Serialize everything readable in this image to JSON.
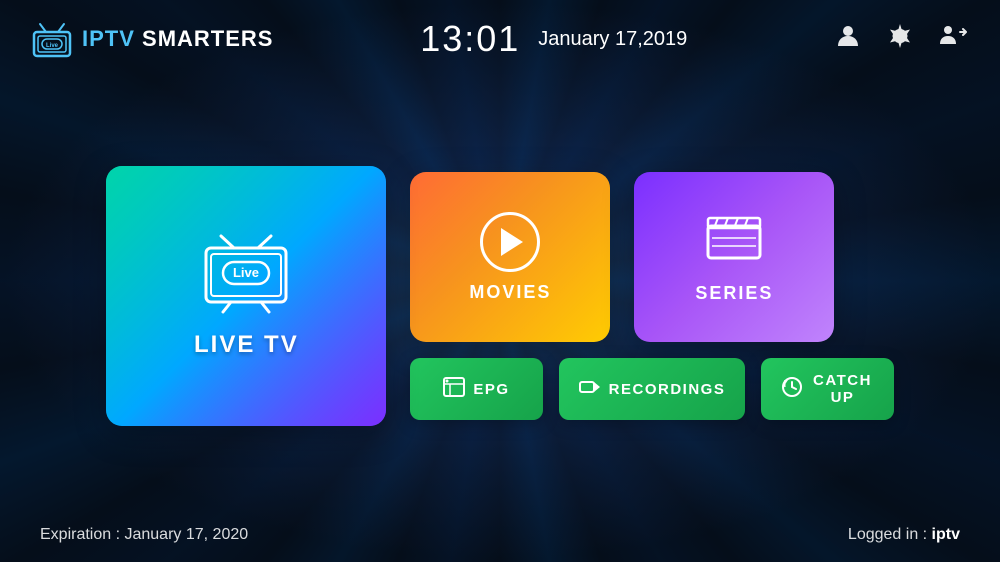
{
  "app": {
    "name": "IPTV SMARTERS",
    "name_prefix": "IPTV",
    "name_suffix": "SMARTERS"
  },
  "header": {
    "time": "13:01",
    "date": "January 17,2019",
    "profile_icon": "👤",
    "settings_icon": "⚙",
    "switch_icon": "👥"
  },
  "cards": {
    "live_tv": {
      "label": "LIVE TV"
    },
    "movies": {
      "label": "MOVIES"
    },
    "series": {
      "label": "SERIES"
    }
  },
  "buttons": {
    "epg": {
      "label": "EPG"
    },
    "recordings": {
      "label": "RECORDINGS"
    },
    "catch_up": {
      "label": "CATCH UP"
    }
  },
  "footer": {
    "expiration_prefix": "Expiration : ",
    "expiration_date": "January 17, 2020",
    "logged_in_prefix": "Logged in : ",
    "logged_in_user": "iptv"
  },
  "colors": {
    "live_tv_gradient_start": "#00d4aa",
    "live_tv_gradient_mid": "#00a8ff",
    "live_tv_gradient_end": "#7b2fff",
    "movies_gradient_start": "#ff6b35",
    "movies_gradient_end": "#ffcc02",
    "series_gradient_start": "#7b2fff",
    "series_gradient_end": "#c084fc",
    "button_green": "#22c55e"
  }
}
